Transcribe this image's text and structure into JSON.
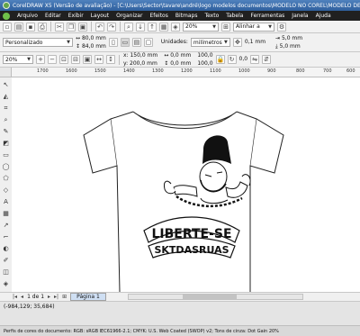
{
  "window": {
    "title": "CorelDRAW X5 (Versão de avaliação) - [C:\\Users\\Sector\\tavare\\andré\\logo modelos documentos\\MODELO NO COREL\\MODELO DE CAMISETA"
  },
  "menu": [
    "Arquivo",
    "Editar",
    "Exibir",
    "Layout",
    "Organizar",
    "Efeitos",
    "Bitmaps",
    "Texto",
    "Tabela",
    "Ferramentas",
    "Janela",
    "Ajuda"
  ],
  "toolbar1": {
    "zoom": "20%",
    "align_label": "Alinhar a"
  },
  "property_bar": {
    "preset": "Personalizado",
    "width": "80,0 mm",
    "height": "84,0 mm",
    "units_label": "Unidades:",
    "units": "milímetros",
    "nudge": "0,1 mm",
    "dup_x": "5,0 mm",
    "dup_y": "5,0 mm"
  },
  "toolbar3": {
    "zoom": "20%",
    "pos_x": "150,0 mm",
    "pos_y": "200,0 mm",
    "size_w": "0,0 mm",
    "size_h": "0,0 mm",
    "scale_w": "100,0",
    "scale_h": "100,0",
    "angle": "0,0"
  },
  "ruler": {
    "ticks": [
      "1700",
      "1600",
      "1500",
      "1400",
      "1300",
      "1200",
      "1100",
      "1000",
      "900",
      "800",
      "700",
      "600"
    ]
  },
  "artwork": {
    "line1": "LIBERTE-SE",
    "line2": "SKTDASRUAS"
  },
  "pages": {
    "info": "1 de 1",
    "tab": "Página 1"
  },
  "coords": "(-984,129; 35,684)",
  "status": "Perfis de cores do documento: RGB: sRGB IEC61966-2.1; CMYK: U.S. Web Coated (SWOP) v2; Tons de cinza: Dot Gain 20%"
}
